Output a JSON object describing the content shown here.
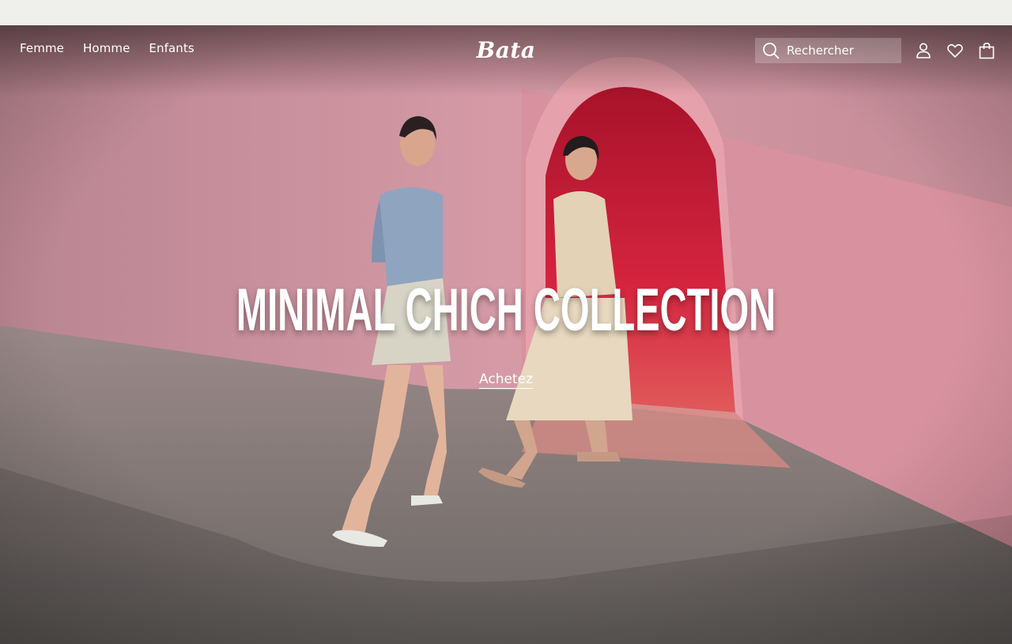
{
  "nav": {
    "items": [
      {
        "label": "Femme"
      },
      {
        "label": "Homme"
      },
      {
        "label": "Enfants"
      }
    ]
  },
  "brand": {
    "logo_text": "Bata"
  },
  "search": {
    "placeholder": "Rechercher"
  },
  "header_icons": [
    "search-icon",
    "account-icon",
    "wishlist-heart-icon",
    "shopping-bag-icon"
  ],
  "hero": {
    "headline": "MINIMAL CHICH COLLECTION",
    "cta_label": "Achetez"
  },
  "colors": {
    "top_bar": "#efefeb",
    "wall_pink": "#c58e99",
    "arch_red": "#c8203a",
    "floor_grey": "#7b7473",
    "text": "#ffffff"
  }
}
